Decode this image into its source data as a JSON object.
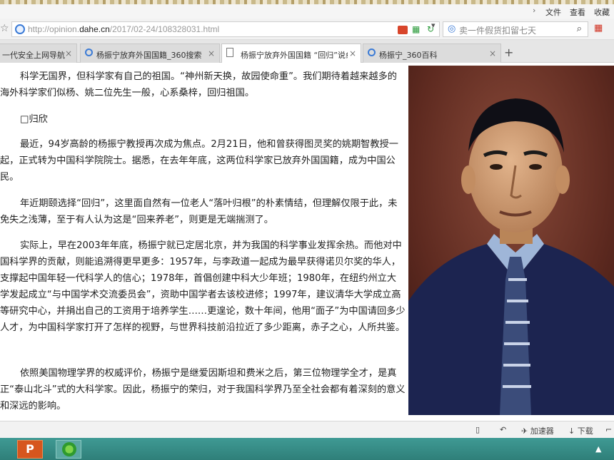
{
  "menu": {
    "items": [
      "文件",
      "查看",
      "收藏"
    ]
  },
  "address": {
    "url_prefix": "http://opinion.",
    "url_domain": "dahe.cn",
    "url_path": "/2017/02-24/108328031.html",
    "search_placeholder": "卖一件假货扣留七天"
  },
  "tabs": [
    {
      "label": "一代安全上网导航"
    },
    {
      "label": "杨振宁放弃外国国籍_360搜索"
    },
    {
      "label": "杨振宁放弃外国国籍 “回归”说纟"
    },
    {
      "label": "杨振宁_360百科"
    }
  ],
  "article": {
    "paragraphs": [
      "科学无国界，但科学家有自己的祖国。“神州新天换，故园使命重”。我们期待着越来越多的海外科学家们似杨、姚二位先生一般，心系桑梓，回归祖国。",
      "□归欣",
      "最近，94岁高龄的杨振宁教授再次成为焦点。2月21日，他和曾获得图灵奖的姚期智教授一起，正式转为中国科学院院士。据悉，在去年年底，这两位科学家已放弃外国国籍，成为中国公民。",
      "年近期颐选择“回归”，这里面自然有一位老人“落叶归根”的朴素情结，但理解仅限于此，未免失之浅薄，至于有人认为这是“回来养老”，则更是无端揣测了。",
      "实际上，早在2003年年底，杨振宁就已定居北京，并为我国的科学事业发挥余热。而他对中国科学界的贡献，则能追溯得更早更多：1957年，与李政道一起成为最早获得诺贝尔奖的华人，支撑起中国年轻一代科学人的信心；1978年，首倡创建中科大少年班；1980年，在纽约州立大学发起成立“与中国学术交流委员会”，资助中国学者去该校进修；1997年，建议清华大学成立高等研究中心，并捐出自己的工资用于培养学生……更遑论，数十年间，他用“面子”为中国请回多少人才，为中国科学家打开了怎样的视野，与世界科技前沿拉近了多少距离，赤子之心，人所共鉴。",
      "依照美国物理学界的权威评价，杨振宁是继爱因斯坦和费米之后，第三位物理学全才，是真正“泰山北斗”式的大科学家。因此，杨振宁的荣归，对于我国科学界乃至全社会都有着深刻的意义和深远的影响。"
    ]
  },
  "status": {
    "accelerator_label": "加速器",
    "download_label": "下载"
  },
  "taskbar": {
    "ppt_letter": "P"
  },
  "colors": {
    "taskbar": "#2f7f79",
    "accent": "#3b7bd6"
  }
}
